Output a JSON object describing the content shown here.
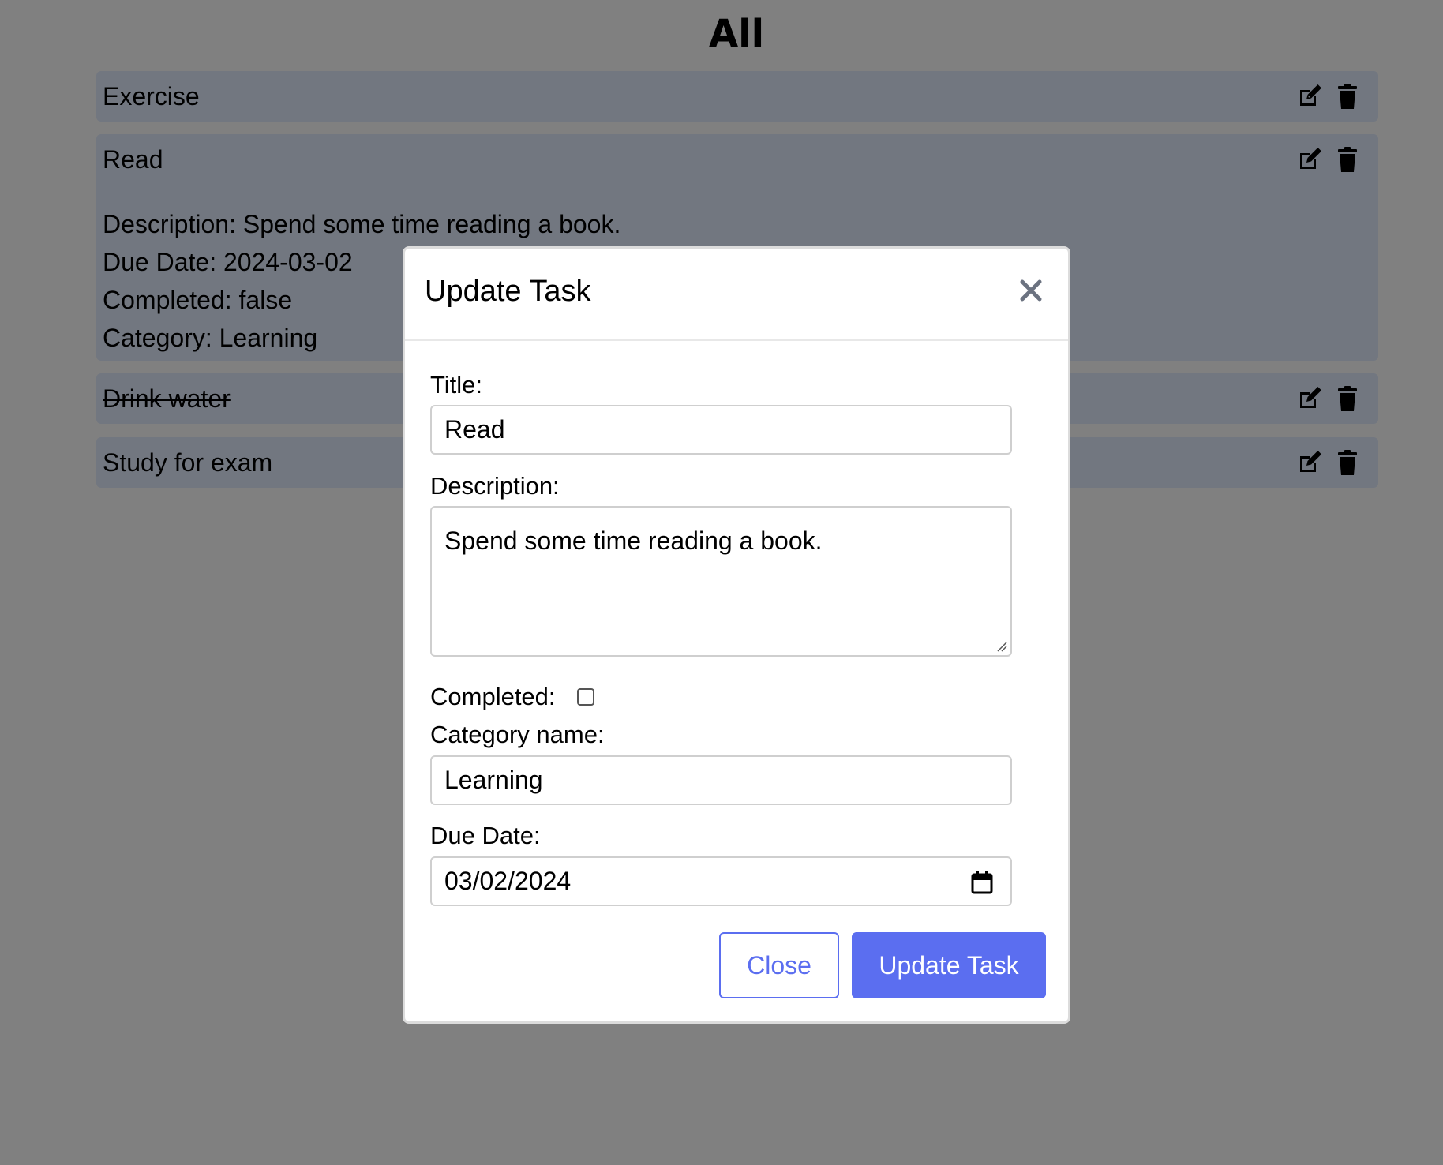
{
  "header": {
    "title": "All"
  },
  "tasks": [
    {
      "title": "Exercise",
      "completed": false
    },
    {
      "title": "Read",
      "completed": false,
      "details": {
        "description": "Description: Spend some time reading a book.",
        "due_date": "Due Date: 2024-03-02",
        "completed": "Completed: false",
        "category": "Category: Learning"
      }
    },
    {
      "title": "Drink water",
      "completed": true
    },
    {
      "title": "Study for exam",
      "completed": false
    }
  ],
  "modal": {
    "title": "Update Task",
    "title_label": "Title:",
    "title_value": "Read",
    "description_label": "Description:",
    "description_value": "Spend some time reading a book.",
    "completed_label": "Completed:",
    "completed_checked": false,
    "category_label": "Category name:",
    "category_value": "Learning",
    "due_label": "Due Date:",
    "due_value": "03/02/2024",
    "close_label": "Close",
    "update_label": "Update Task"
  },
  "colors": {
    "overlay": "#808080",
    "task_bg": "#727780",
    "primary": "#5b6ef0"
  },
  "icons": [
    "edit-icon",
    "trash-icon",
    "close-icon",
    "calendar-icon",
    "resize-grip-icon"
  ]
}
